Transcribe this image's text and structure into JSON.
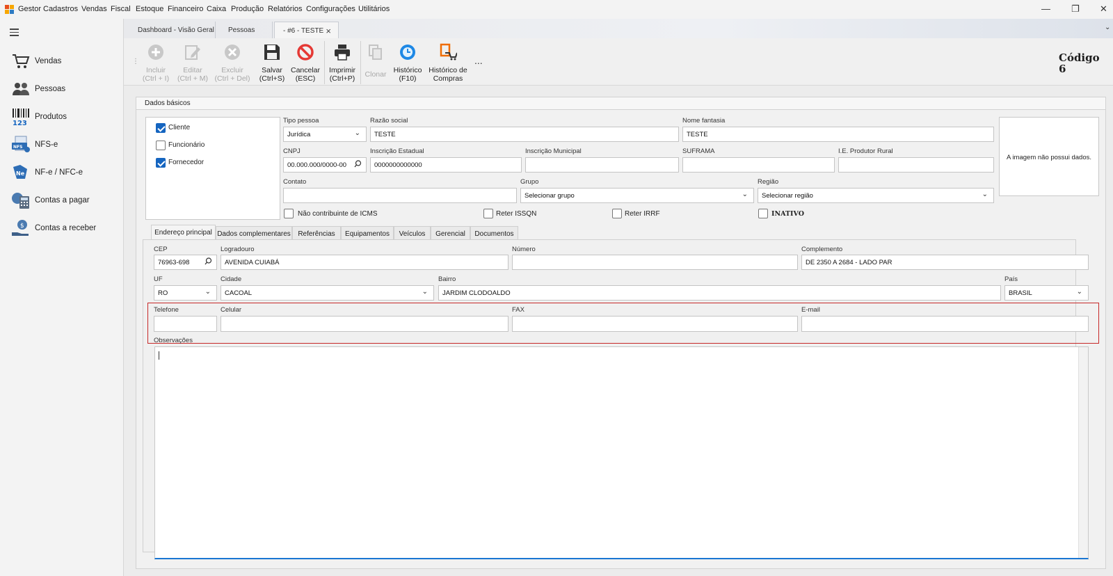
{
  "menubar": {
    "items": [
      "Gestor",
      "Cadastros",
      "Vendas",
      "Fiscal",
      "Estoque",
      "Financeiro",
      "Caixa",
      "Produção",
      "Relatórios",
      "Configurações",
      "Utilitários"
    ]
  },
  "sidebar": {
    "items": [
      {
        "label": "Vendas",
        "icon": "cart-icon"
      },
      {
        "label": "Pessoas",
        "icon": "people-icon"
      },
      {
        "label": "Produtos",
        "icon": "barcode-icon"
      },
      {
        "label": "NFS-e",
        "icon": "nfse-icon"
      },
      {
        "label": "NF-e / NFC-e",
        "icon": "nfe-icon"
      },
      {
        "label": "Contas a pagar",
        "icon": "calculator-icon"
      },
      {
        "label": "Contas a receber",
        "icon": "money-hand-icon"
      }
    ]
  },
  "tabs": [
    {
      "label": "Dashboard - Visão Geral"
    },
    {
      "label": "Pessoas"
    },
    {
      "label": "- #6 - TESTE"
    }
  ],
  "toolbar": {
    "incluir": [
      "Incluir",
      "(Ctrl + I)"
    ],
    "editar": [
      "Editar",
      "(Ctrl + M)"
    ],
    "excluir": [
      "Excluir",
      "(Ctrl + Del)"
    ],
    "salvar": [
      "Salvar",
      "(Ctrl+S)"
    ],
    "cancelar": [
      "Cancelar",
      "(ESC)"
    ],
    "imprimir": [
      "Imprimir",
      "(Ctrl+P)"
    ],
    "clonar": "Clonar",
    "historico": [
      "Histórico",
      "(F10)"
    ],
    "historico_compras": [
      "Histórico de",
      "Compras"
    ],
    "more": "...",
    "codigo_label": "Código",
    "codigo_value": "6"
  },
  "form": {
    "section_title": "Dados básicos",
    "cliente": "Cliente",
    "funcionario": "Funcionário",
    "fornecedor": "Fornecedor",
    "tipo_pessoa_label": "Tipo pessoa",
    "tipo_pessoa_value": "Jurídica",
    "razao_social_label": "Razão social",
    "razao_social_value": "TESTE",
    "nome_fantasia_label": "Nome fantasia",
    "nome_fantasia_value": "TESTE",
    "cnpj_label": "CNPJ",
    "cnpj_value": "00.000.000/0000-00",
    "ie_label": "Inscrição Estadual",
    "ie_value": "0000000000000",
    "im_label": "Inscrição Municipal",
    "suframa_label": "SUFRAMA",
    "produtor_label": "I.E. Produtor Rural",
    "contato_label": "Contato",
    "grupo_label": "Grupo",
    "grupo_value": "Selecionar grupo",
    "regiao_label": "Região",
    "regiao_value": "Selecionar região",
    "nao_contribuinte": "Não contribuinte de ICMS",
    "reter_issqn": "Reter ISSQN",
    "reter_irrf": "Reter IRRF",
    "inativo": "INATIVO",
    "image_text": "A imagem não possui dados."
  },
  "subtabs": [
    "Endereço principal",
    "Dados complementares",
    "Referências",
    "Equipamentos",
    "Veículos",
    "Gerencial",
    "Documentos"
  ],
  "address": {
    "cep_label": "CEP",
    "cep_value": "76963-698",
    "logradouro_label": "Logradouro",
    "logradouro_value": "AVENIDA CUIABÁ",
    "numero_label": "Número",
    "complemento_label": "Complemento",
    "complemento_value": "DE 2350 A 2684 - LADO PAR",
    "uf_label": "UF",
    "uf_value": "RO",
    "cidade_label": "Cidade",
    "cidade_value": "CACOAL",
    "bairro_label": "Bairro",
    "bairro_value": "JARDIM CLODOALDO",
    "pais_label": "País",
    "pais_value": "BRASIL",
    "telefone_label": "Telefone",
    "celular_label": "Celular",
    "fax_label": "FAX",
    "email_label": "E-mail",
    "observacoes_label": "Observações"
  }
}
